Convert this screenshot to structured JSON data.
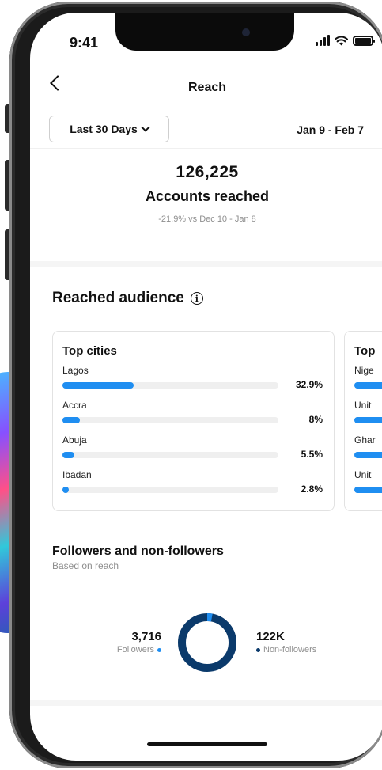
{
  "status_bar": {
    "time": "9:41"
  },
  "header": {
    "title": "Reach"
  },
  "range": {
    "selected": "Last 30 Days",
    "dates": "Jan 9 - Feb 7"
  },
  "summary": {
    "value": "126,225",
    "label": "Accounts reached",
    "delta": "-21.9% vs Dec 10 - Jan 8"
  },
  "audience": {
    "title": "Reached audience",
    "cities_card": {
      "title": "Top cities",
      "rows": [
        {
          "label": "Lagos",
          "pct": "32.9%",
          "fill": 0.329
        },
        {
          "label": "Accra",
          "pct": "8%",
          "fill": 0.08
        },
        {
          "label": "Abuja",
          "pct": "5.5%",
          "fill": 0.055
        },
        {
          "label": "Ibadan",
          "pct": "2.8%",
          "fill": 0.028
        }
      ]
    },
    "countries_card": {
      "title": "Top",
      "rows": [
        {
          "label": "Nige"
        },
        {
          "label": "Unit"
        },
        {
          "label": "Ghar"
        },
        {
          "label": "Unit"
        }
      ]
    }
  },
  "followers": {
    "title": "Followers and non-followers",
    "subtitle": "Based on reach",
    "followers_value": "3,716",
    "followers_label": "Followers",
    "followers_share": 0.029,
    "nonfollowers_value": "122K",
    "nonfollowers_label": "Non-followers",
    "colors": {
      "followers": "#1f8ef1",
      "nonfollowers": "#0b3a6b"
    }
  }
}
